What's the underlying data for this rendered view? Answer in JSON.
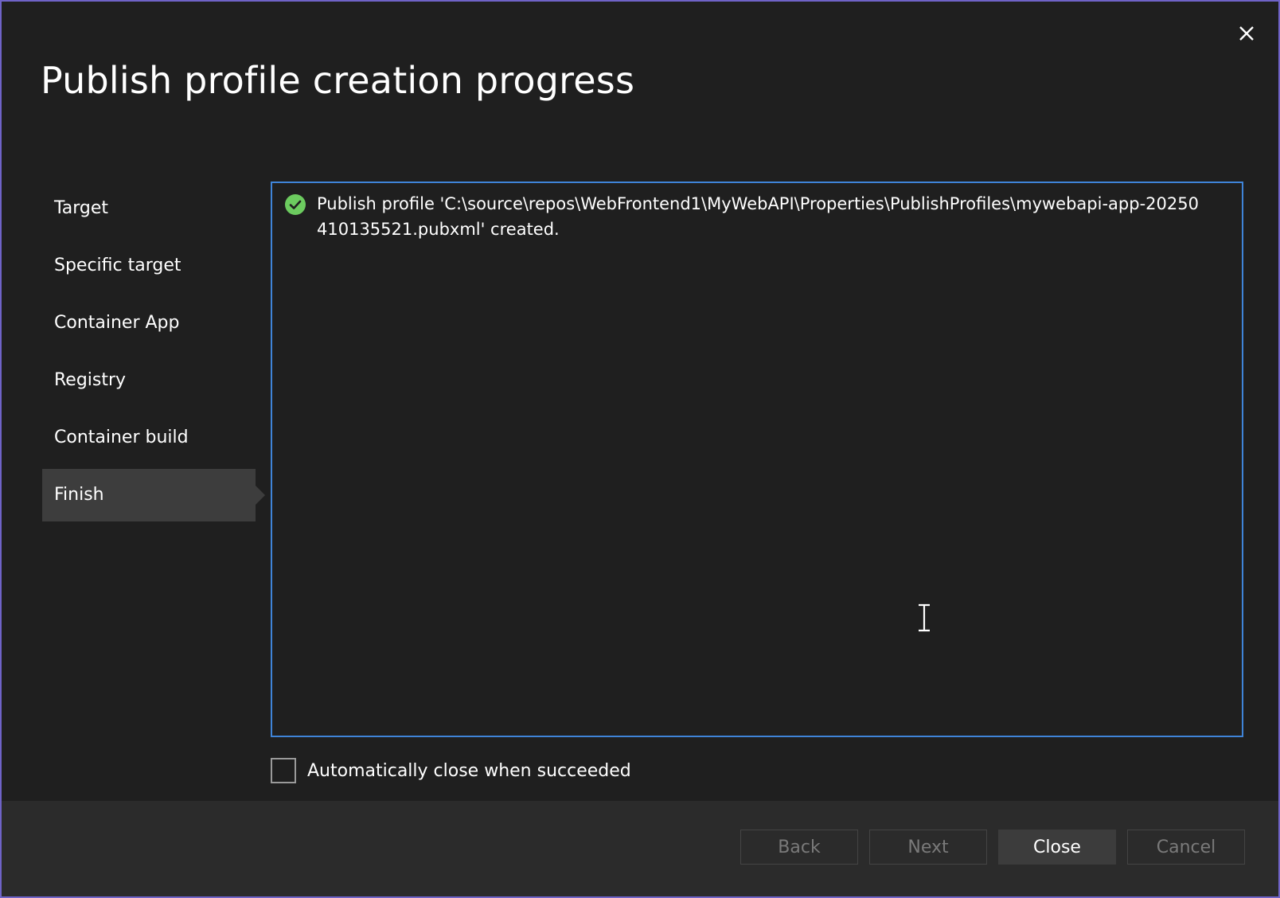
{
  "dialog": {
    "title": "Publish profile creation progress",
    "close_icon": "close-icon"
  },
  "steps": [
    {
      "label": "Target",
      "active": false
    },
    {
      "label": "Specific target",
      "active": false
    },
    {
      "label": "Container App",
      "active": false
    },
    {
      "label": "Registry",
      "active": false
    },
    {
      "label": "Container build",
      "active": false
    },
    {
      "label": "Finish",
      "active": true
    }
  ],
  "log": {
    "status_icon": "check-circle-icon",
    "status_color": "#6ccb5f",
    "message": "Publish profile 'C:\\source\\repos\\WebFrontend1\\MyWebAPI\\Properties\\PublishProfiles\\mywebapi-app-20250410135521.pubxml' created."
  },
  "auto_close": {
    "label": "Automatically close when succeeded",
    "checked": false
  },
  "buttons": {
    "back": {
      "label": "Back",
      "enabled": false
    },
    "next": {
      "label": "Next",
      "enabled": false
    },
    "close": {
      "label": "Close",
      "enabled": true
    },
    "cancel": {
      "label": "Cancel",
      "enabled": false
    }
  },
  "colors": {
    "accent_border": "#3f84d8",
    "window_border": "#6f63c7"
  }
}
